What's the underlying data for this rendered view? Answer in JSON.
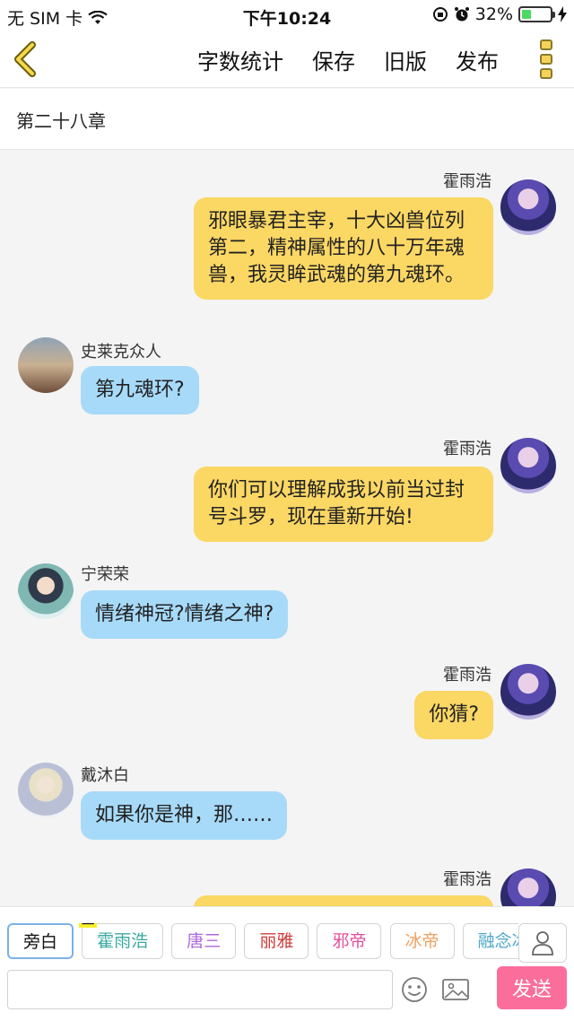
{
  "status_bar": {
    "carrier": "无 SIM 卡",
    "time": "下午10:24",
    "battery": "32%",
    "battery_fraction": 0.32
  },
  "nav": {
    "actions": [
      "字数统计",
      "保存",
      "旧版",
      "发布"
    ]
  },
  "chapter": {
    "title": "第二十八章"
  },
  "messages": [
    {
      "name": "霍雨浩",
      "text": "邪眼暴君主宰，十大凶兽位列第二，精神属性的八十万年魂兽，我灵眸武魂的第九魂环。"
    },
    {
      "name": "史莱克众人",
      "text": "第九魂环?"
    },
    {
      "name": "霍雨浩",
      "text": "你们可以理解成我以前当过封号斗罗，现在重新开始!"
    },
    {
      "name": "宁荣荣",
      "text": "情绪神冠?情绪之神?"
    },
    {
      "name": "霍雨浩",
      "text": "你猜?"
    },
    {
      "name": "戴沐白",
      "text": "如果你是神，那……"
    },
    {
      "name": "霍雨浩",
      "text": ""
    }
  ],
  "characters": {
    "main_tag": "主",
    "chips": [
      {
        "label": "旁白",
        "color": "#222222"
      },
      {
        "label": "霍雨浩",
        "color": "#3aa8a0"
      },
      {
        "label": "唐三",
        "color": "#b06ad6"
      },
      {
        "label": "丽雅",
        "color": "#d23b3b"
      },
      {
        "label": "邪帝",
        "color": "#e24f9c"
      },
      {
        "label": "冰帝",
        "color": "#f0a060"
      },
      {
        "label": "融念冰",
        "color": "#4aa8c8"
      }
    ]
  },
  "composer": {
    "value": "",
    "placeholder": "",
    "send_label": "发送"
  }
}
